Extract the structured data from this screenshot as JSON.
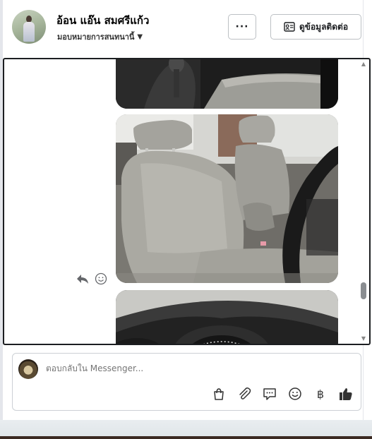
{
  "header": {
    "name": "อ้อน แอ๊น สมศรีแก้ว",
    "role_label": "มอบหมายการสนทนานี้",
    "more_button_label": "···",
    "contact_button_label": "ดูข้อมูลติดต่อ"
  },
  "conversation": {
    "photos": [
      "car-gear-shift-photo",
      "car-seats-photo",
      "car-dashboard-photo"
    ],
    "reaction_icons": [
      "reply-icon",
      "emoji-react-icon"
    ]
  },
  "composer": {
    "placeholder": "ตอบกลับใน Messenger...",
    "icons": [
      "bag-icon",
      "attachment-icon",
      "saved-reply-icon",
      "emoji-icon",
      "baht-icon",
      "like-icon"
    ],
    "baht_symbol": "฿"
  },
  "colors": {
    "accent": "#1c1e21",
    "border": "#bcc0c4",
    "muted": "#65676b"
  }
}
